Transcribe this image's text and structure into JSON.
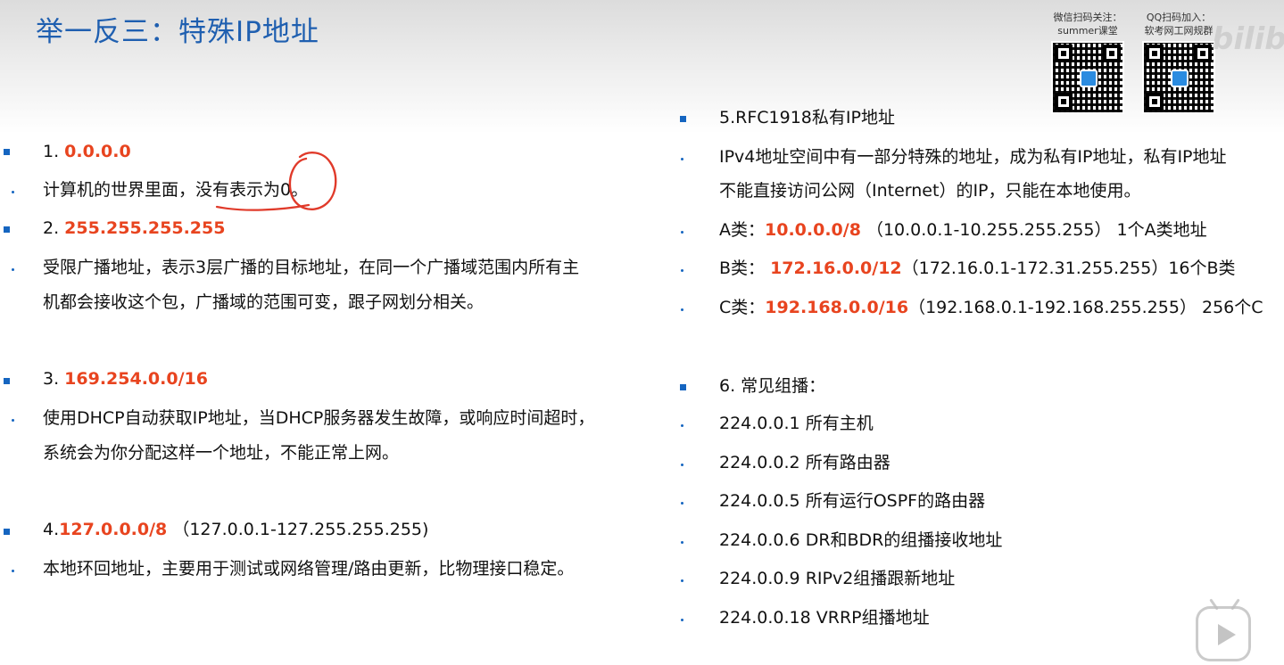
{
  "title": "举一反三：特殊IP地址",
  "qr_codes": [
    {
      "caption_line1": "微信扫码关注：",
      "caption_line2": "summer课堂"
    },
    {
      "caption_line1": "QQ扫码加入：",
      "caption_line2": "软考网工网规群"
    }
  ],
  "watermark": "bilibili",
  "colors": {
    "title": "#1f5fb0",
    "highlight": "#e8441f",
    "bullet": "#1565c0",
    "annotation": "#e03a2a"
  },
  "left": {
    "s1": {
      "num": "1. ",
      "ip": "0.0.0.0",
      "desc": "计算机的世界里面，没有表示为0。"
    },
    "s2": {
      "num": "2. ",
      "ip": "255.255.255.255",
      "desc1": "受限广播地址，表示3层广播的目标地址，在同一个广播域范围内所有主",
      "desc2": "机都会接收这个包，广播域的范围可变，跟子网划分相关。"
    },
    "s3": {
      "num": "3. ",
      "ip": "169.254.0.0/16",
      "desc1": "使用DHCP自动获取IP地址，当DHCP服务器发生故障，或响应时间超时，",
      "desc2": "系统会为你分配这样一个地址，不能正常上网。"
    },
    "s4": {
      "num": "4.",
      "ip": "127.0.0.0/8",
      "range": " （127.0.0.1-127.255.255.255)",
      "desc": "本地环回地址，主要用于测试或网络管理/路由更新，比物理接口稳定。"
    }
  },
  "right": {
    "s5": {
      "heading": "5.RFC1918私有IP地址",
      "desc1": "IPv4地址空间中有一部分特殊的地址，成为私有IP地址，私有IP地址",
      "desc2": "不能直接访问公网（Internet）的IP，只能在本地使用。",
      "a": {
        "label": "A类：",
        "ip": "10.0.0.0/8",
        "rest": " （10.0.0.1-10.255.255.255） 1个A类地址"
      },
      "b": {
        "label": "B类： ",
        "ip": "172.16.0.0/12",
        "rest": "（172.16.0.1-172.31.255.255）16个B类"
      },
      "c": {
        "label": "C类：",
        "ip": "192.168.0.0/16",
        "rest": "（192.168.0.1-192.168.255.255） 256个C"
      }
    },
    "s6": {
      "heading": "6. 常见组播：",
      "items": [
        "224.0.0.1 所有主机",
        "224.0.0.2 所有路由器",
        "224.0.0.5 所有运行OSPF的路由器",
        "224.0.0.6 DR和BDR的组播接收地址",
        "224.0.0.9 RIPv2组播跟新地址",
        "224.0.0.18 VRRP组播地址"
      ]
    }
  }
}
